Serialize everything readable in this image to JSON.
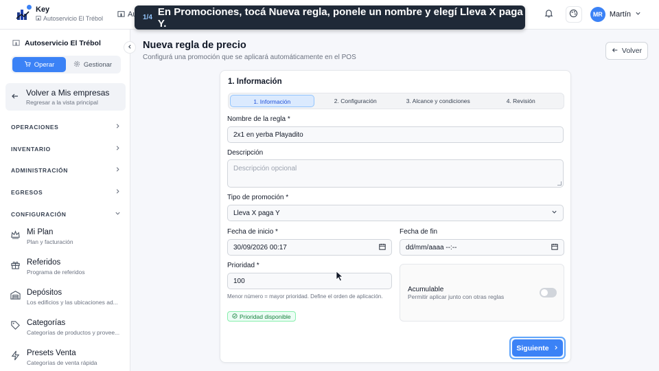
{
  "app": {
    "name": "Key",
    "store": "Autoservicio El Trébol",
    "nav_peek": "Au"
  },
  "user": {
    "initials": "MR",
    "name": "Martín"
  },
  "tour": {
    "step": "1/4",
    "text": "En Promociones, tocá Nueva regla, ponele un nombre y elegí Lleva X paga Y."
  },
  "sidebar": {
    "store": "Autoservicio El Trébol",
    "modes": [
      {
        "label": "Operar",
        "active": true
      },
      {
        "label": "Gestionar",
        "active": false
      }
    ],
    "back": {
      "title": "Volver a Mis empresas",
      "subtitle": "Regresar a la vista principal"
    },
    "sections": [
      "OPERACIONES",
      "INVENTARIO",
      "ADMINISTRACIÓN",
      "EGRESOS",
      "CONFIGURACIÓN"
    ],
    "items": [
      {
        "title": "Mi Plan",
        "subtitle": "Plan y facturación"
      },
      {
        "title": "Referidos",
        "subtitle": "Programa de referidos"
      },
      {
        "title": "Depósitos",
        "subtitle": "Los edificios y las ubicaciones ad..."
      },
      {
        "title": "Categorías",
        "subtitle": "Categorías de productos y provee..."
      },
      {
        "title": "Presets Venta",
        "subtitle": "Categorías de venta rápida"
      }
    ]
  },
  "page": {
    "title": "Nueva regla de precio",
    "subtitle": "Configurá una promoción que se aplicará automáticamente en el POS",
    "back_label": "Volver"
  },
  "form": {
    "card_title": "1. Información",
    "steps": [
      "1. Información",
      "2. Configuración",
      "3. Alcance y condiciones",
      "4. Revisión"
    ],
    "name_label": "Nombre de la regla *",
    "name_value": "2x1 en yerba Playadito",
    "desc_label": "Descripción",
    "desc_placeholder": "Descripción opcional",
    "type_label": "Tipo de promoción *",
    "type_value": "Lleva X paga Y",
    "start_label": "Fecha de inicio *",
    "start_value": "30/09/2026 00:17",
    "end_label": "Fecha de fin",
    "end_placeholder": "dd/mm/aaaa --:--",
    "priority_label": "Prioridad *",
    "priority_value": "100",
    "priority_help": "Menor número = mayor prioridad. Define el orden de aplicación.",
    "priority_badge": "Prioridad disponible",
    "cumulative_title": "Acumulable",
    "cumulative_sub": "Permitir aplicar junto con otras reglas",
    "next_label": "Siguiente"
  }
}
